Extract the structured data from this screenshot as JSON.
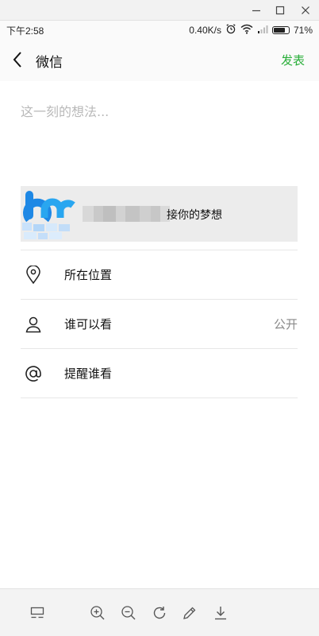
{
  "window": {
    "minimize_icon": "minimize-icon",
    "maximize_icon": "maximize-icon",
    "close_icon": "close-icon"
  },
  "status_bar": {
    "time": "下午2:58",
    "network_speed": "0.40K/s",
    "battery_percent": "71%",
    "battery_level": 0.71
  },
  "nav": {
    "back_icon": "chevron-left-icon",
    "title": "微信",
    "publish_label": "发表",
    "accent_color": "#2aae3a"
  },
  "compose": {
    "placeholder": "这一刻的想法..."
  },
  "link_card": {
    "text": "接你的梦想"
  },
  "options": [
    {
      "icon": "location-pin-icon",
      "label": "所在位置",
      "value": ""
    },
    {
      "icon": "person-icon",
      "label": "谁可以看",
      "value": "公开"
    },
    {
      "icon": "at-sign-icon",
      "label": "提醒谁看",
      "value": ""
    }
  ],
  "toolbar": {
    "icons": [
      "layout-icon",
      "zoom-in-icon",
      "zoom-out-icon",
      "rotate-icon",
      "edit-icon",
      "download-icon"
    ]
  }
}
